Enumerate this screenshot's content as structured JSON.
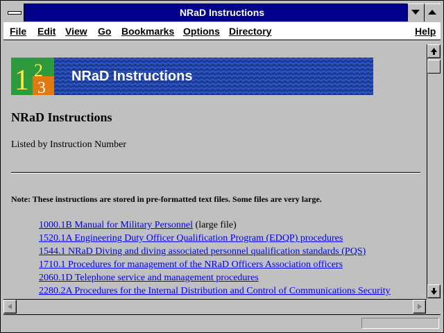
{
  "window": {
    "title": "NRaD Instructions"
  },
  "menu": [
    "File",
    "Edit",
    "View",
    "Go",
    "Bookmarks",
    "Options",
    "Directory",
    "Help"
  ],
  "banner": {
    "logo_digits": [
      "1",
      "2",
      "3"
    ],
    "text": "NRaD Instructions"
  },
  "page": {
    "heading": "NRaD Instructions",
    "subheading": "Listed by Instruction Number",
    "note": "Note: These instructions are stored in pre-formatted text files. Some files are very large.",
    "links": [
      {
        "text": "1000.1B Manual for Military Personnel",
        "suffix": " (large file)"
      },
      {
        "text": "1520.1A Engineering Duty Officer Qualification Program (EDQP) procedures ",
        "suffix": ""
      },
      {
        "text": "1544.1 NRaD Diving and diving associated personnel qualification standards (PQS)",
        "suffix": ""
      },
      {
        "text": "1710.1 Procedures for management of the NRaD Officers Association officers",
        "suffix": ""
      },
      {
        "text": "2060.1D Telephone service and management procedures",
        "suffix": ""
      },
      {
        "text": "2280.2A Procedures for the Internal Distribution and Control of Communications Security",
        "suffix": ""
      }
    ]
  },
  "colors": {
    "titlebar": "#00008b",
    "link": "#0000ee",
    "banner": "#1e3fa0"
  },
  "icons": [
    "system-menu-icon",
    "minimize-icon",
    "maximize-icon",
    "scroll-up-icon",
    "scroll-down-icon",
    "scroll-left-icon",
    "scroll-right-icon"
  ]
}
